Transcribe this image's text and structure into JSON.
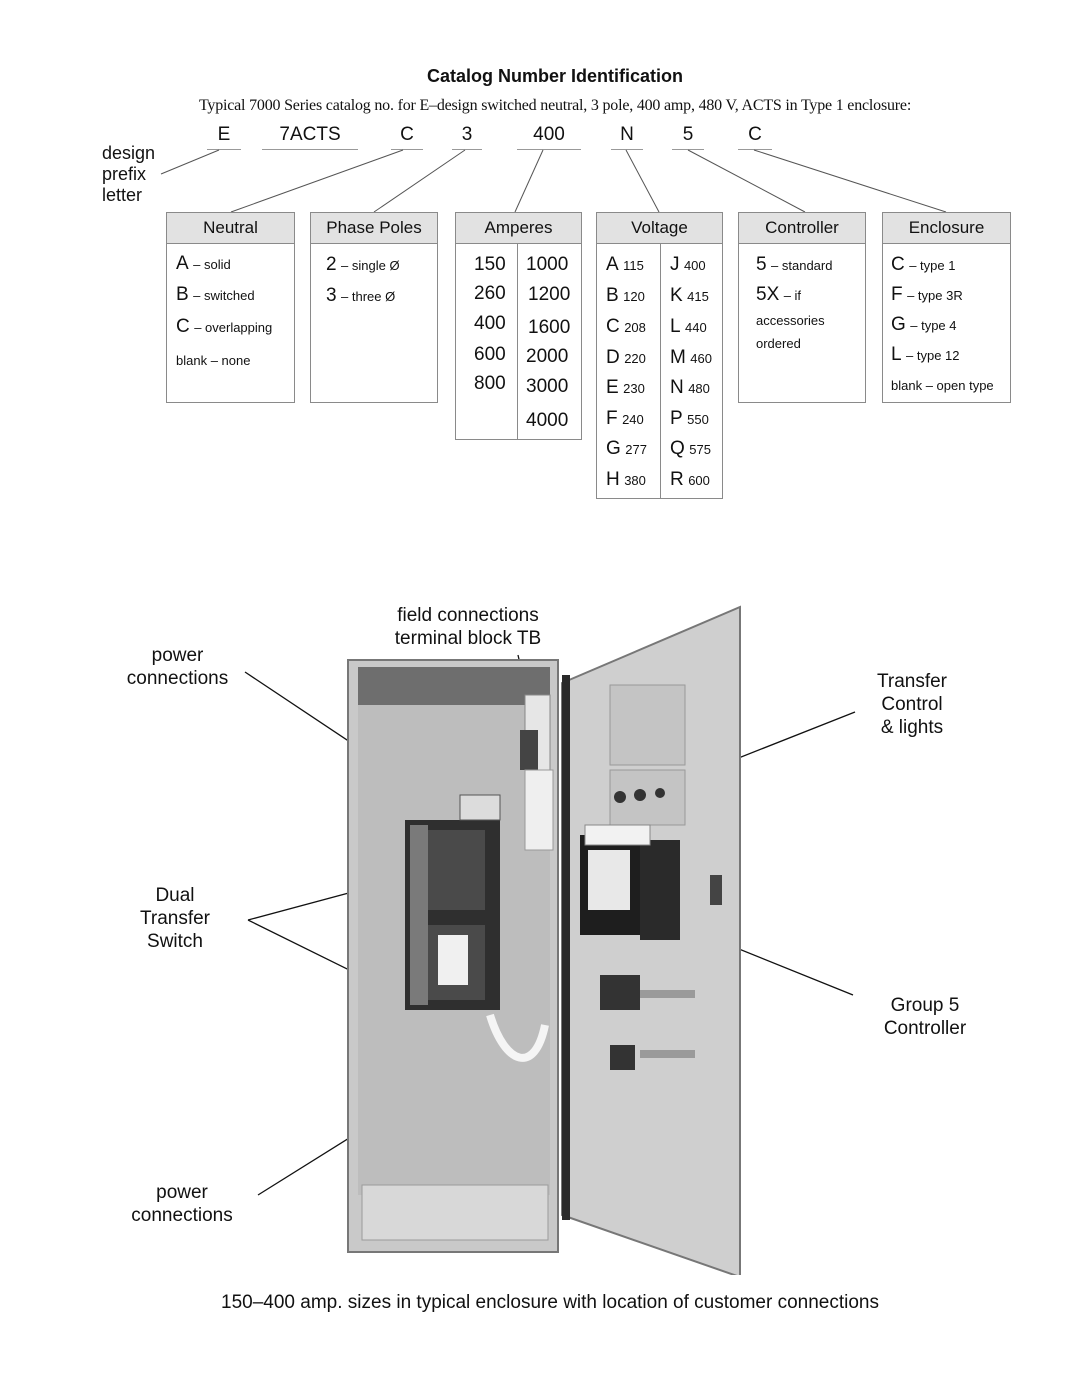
{
  "header": {
    "title": "Catalog Number Identification",
    "subtitle": "Typical 7000 Series catalog no. for E–design switched neutral, 3 pole, 400 amp, 480 V, ACTS in Type 1 enclosure:"
  },
  "catalog_segments": [
    "E",
    "7ACTS",
    "C",
    "3",
    "400",
    "N",
    "5",
    "C"
  ],
  "prefix_label": [
    "design",
    "prefix",
    "letter"
  ],
  "tables": {
    "neutral": {
      "header": "Neutral",
      "items": [
        {
          "code": "A",
          "desc": "– solid"
        },
        {
          "code": "B",
          "desc": "– switched"
        },
        {
          "code": "C",
          "desc": "– overlapping"
        },
        {
          "code": "blank",
          "desc": "– none"
        }
      ]
    },
    "phase_poles": {
      "header": "Phase Poles",
      "items": [
        {
          "code": "2",
          "desc": "– single Ø"
        },
        {
          "code": "3",
          "desc": "– three Ø"
        }
      ]
    },
    "amperes": {
      "header": "Amperes",
      "col1": [
        "150",
        "260",
        "400",
        "600",
        "800"
      ],
      "col2": [
        "1000",
        "1200",
        "1600",
        "2000",
        "3000",
        "4000"
      ]
    },
    "voltage": {
      "header": "Voltage",
      "col1": [
        {
          "code": "A",
          "value": "115"
        },
        {
          "code": "B",
          "value": "120"
        },
        {
          "code": "C",
          "value": "208"
        },
        {
          "code": "D",
          "value": "220"
        },
        {
          "code": "E",
          "value": "230"
        },
        {
          "code": "F",
          "value": "240"
        },
        {
          "code": "G",
          "value": "277"
        },
        {
          "code": "H",
          "value": "380"
        }
      ],
      "col2": [
        {
          "code": "J",
          "value": "400"
        },
        {
          "code": "K",
          "value": "415"
        },
        {
          "code": "L",
          "value": "440"
        },
        {
          "code": "M",
          "value": "460"
        },
        {
          "code": "N",
          "value": "480"
        },
        {
          "code": "P",
          "value": "550"
        },
        {
          "code": "Q",
          "value": "575"
        },
        {
          "code": "R",
          "value": "600"
        }
      ]
    },
    "controller": {
      "header": "Controller",
      "items": [
        {
          "code": "5",
          "desc": "– standard"
        },
        {
          "code": "5X",
          "desc": "– if"
        }
      ],
      "note": [
        "accessories",
        "ordered"
      ]
    },
    "enclosure": {
      "header": "Enclosure",
      "items": [
        {
          "code": "C",
          "desc": "– type 1"
        },
        {
          "code": "F",
          "desc": "– type 3R"
        },
        {
          "code": "G",
          "desc": "– type 4"
        },
        {
          "code": "L",
          "desc": "– type 12"
        },
        {
          "code": "blank",
          "desc": "– open type"
        }
      ]
    }
  },
  "photo_callouts": {
    "field_connections": [
      "field connections",
      "terminal block TB"
    ],
    "power_connections_top": [
      "power",
      "connections"
    ],
    "dual_transfer_switch": [
      "Dual",
      "Transfer",
      "Switch"
    ],
    "power_connections_bottom": [
      "power",
      "connections"
    ],
    "transfer_control": [
      "Transfer",
      "Control",
      "& lights"
    ],
    "group5_controller": [
      "Group 5",
      "Controller"
    ]
  },
  "caption": "150–400 amp. sizes in typical enclosure with location of customer connections"
}
